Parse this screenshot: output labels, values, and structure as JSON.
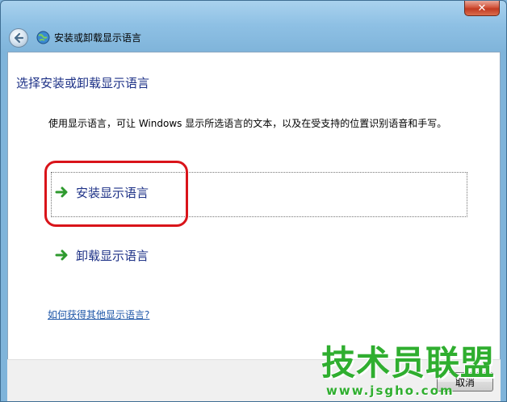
{
  "window": {
    "title": "安装或卸载显示语言",
    "close_glyph": "✕"
  },
  "main": {
    "heading": "选择安装或卸载显示语言",
    "description": "使用显示语言，可让 Windows 显示所选语言的文本，以及在受支持的位置识别语音和手写。",
    "options": [
      {
        "label": "安装显示语言",
        "icon": "green-arrow-icon",
        "selected": true
      },
      {
        "label": "卸载显示语言",
        "icon": "green-arrow-icon",
        "selected": false
      }
    ],
    "help_link": "如何获得其他显示语言?"
  },
  "footer": {
    "cancel_label": "取消"
  },
  "watermark": {
    "text": "技术员联盟",
    "url": "www.jsgho.com"
  },
  "colors": {
    "link_blue": "#1e3287",
    "highlight_red": "#d9141a",
    "arrow_green": "#2e9a2e"
  }
}
